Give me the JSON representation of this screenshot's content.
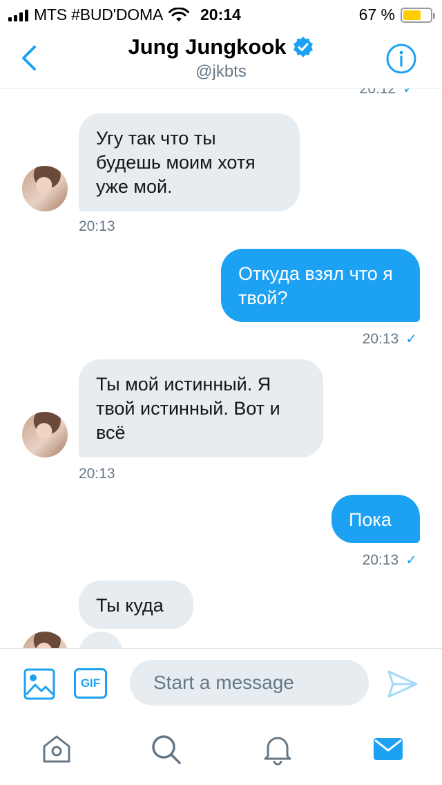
{
  "status_bar": {
    "carrier": "MTS #BUD'DOMA",
    "time": "20:14",
    "battery_percent": "67 %",
    "battery_level": 0.67
  },
  "header": {
    "name": "Jung Jungkook",
    "handle": "@jkbts",
    "verified": true
  },
  "conversation": {
    "partial_top_time": "20:12",
    "messages": [
      {
        "direction": "in",
        "text": "Угу так что ты будешь моим хотя уже мой.",
        "time": "20:13"
      },
      {
        "direction": "out",
        "text": "Откуда взял что я твой?",
        "time": "20:13"
      },
      {
        "direction": "in",
        "text": "Ты мой истинный. Я твой истинный. Вот и всё",
        "time": "20:13"
      },
      {
        "direction": "out",
        "text": "Пока",
        "time": "20:13"
      },
      {
        "direction": "in",
        "text": "Ты куда"
      }
    ]
  },
  "composer": {
    "placeholder": "Start a message",
    "gif_label": "GIF"
  },
  "tabbar": {
    "tabs": [
      {
        "name": "home",
        "icon": "home-icon"
      },
      {
        "name": "search",
        "icon": "search-icon"
      },
      {
        "name": "notifications",
        "icon": "bell-icon"
      },
      {
        "name": "messages",
        "icon": "mail-icon",
        "active": true
      }
    ]
  },
  "colors": {
    "accent": "#1da1f2",
    "incoming_bubble": "#e6ecf0",
    "secondary_text": "#657786",
    "battery": "#ffcc00"
  }
}
